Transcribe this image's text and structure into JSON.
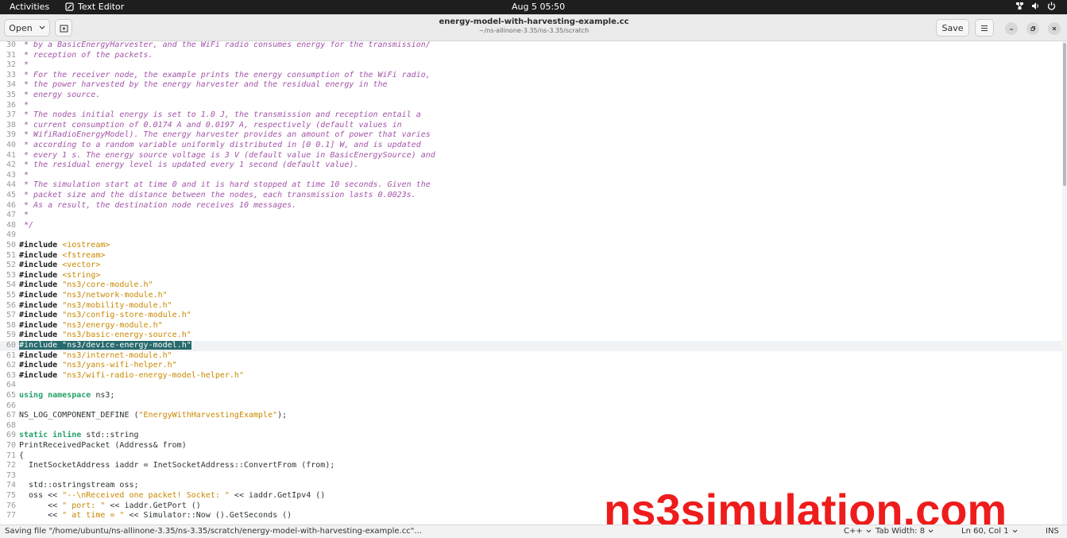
{
  "system": {
    "activities": "Activities",
    "app_name": "Text Editor",
    "clock": "Aug 5  05:50"
  },
  "header": {
    "open_label": "Open",
    "save_label": "Save",
    "title": "energy-model-with-harvesting-example.cc",
    "subtitle": "~/ns-allinone-3.35/ns-3.35/scratch"
  },
  "icons": {
    "app": "text-editor-icon",
    "open_dropdown": "chevron-down-icon",
    "new_tab": "new-tab-icon",
    "menu": "hamburger-menu-icon",
    "tray": [
      "network-icon",
      "volume-icon",
      "power-icon"
    ]
  },
  "colors": {
    "comment": "#a355a9",
    "keyword": "#26a269",
    "string": "#c88800",
    "selection": "#276a6c",
    "watermark": "#ee1c1c"
  },
  "editor": {
    "current_line": 60,
    "lines": [
      {
        "n": "30",
        "parts": [
          {
            "t": " * by a BasicEnergyHarvester, and the WiFi radio consumes energy for the transmission/",
            "c": "comment"
          }
        ]
      },
      {
        "n": "31",
        "parts": [
          {
            "t": " * reception of the packets.",
            "c": "comment"
          }
        ]
      },
      {
        "n": "32",
        "parts": [
          {
            "t": " *",
            "c": "comment"
          }
        ]
      },
      {
        "n": "33",
        "parts": [
          {
            "t": " * For the receiver node, the example prints the energy consumption of the WiFi radio,",
            "c": "comment"
          }
        ]
      },
      {
        "n": "34",
        "parts": [
          {
            "t": " * the power harvested by the energy harvester and the residual energy in the",
            "c": "comment"
          }
        ]
      },
      {
        "n": "35",
        "parts": [
          {
            "t": " * energy source.",
            "c": "comment"
          }
        ]
      },
      {
        "n": "36",
        "parts": [
          {
            "t": " *",
            "c": "comment"
          }
        ]
      },
      {
        "n": "37",
        "parts": [
          {
            "t": " * The nodes initial energy is set to 1.0 J, the transmission and reception entail a",
            "c": "comment"
          }
        ]
      },
      {
        "n": "38",
        "parts": [
          {
            "t": " * current consumption of 0.0174 A and 0.0197 A, respectively (default values in",
            "c": "comment"
          }
        ]
      },
      {
        "n": "39",
        "parts": [
          {
            "t": " * WifiRadioEnergyModel). The energy harvester provides an amount of power that varies",
            "c": "comment"
          }
        ]
      },
      {
        "n": "40",
        "parts": [
          {
            "t": " * according to a random variable uniformly distributed in [0 0.1] W, and is updated",
            "c": "comment"
          }
        ]
      },
      {
        "n": "41",
        "parts": [
          {
            "t": " * every 1 s. The energy source voltage is 3 V (default value in BasicEnergySource) and",
            "c": "comment"
          }
        ]
      },
      {
        "n": "42",
        "parts": [
          {
            "t": " * the residual energy level is updated every 1 second (default value).",
            "c": "comment"
          }
        ]
      },
      {
        "n": "43",
        "parts": [
          {
            "t": " *",
            "c": "comment"
          }
        ]
      },
      {
        "n": "44",
        "parts": [
          {
            "t": " * The simulation start at time 0 and it is hard stopped at time 10 seconds. Given the",
            "c": "comment"
          }
        ]
      },
      {
        "n": "45",
        "parts": [
          {
            "t": " * packet size and the distance between the nodes, each transmission lasts 0.0023s.",
            "c": "comment"
          }
        ]
      },
      {
        "n": "46",
        "parts": [
          {
            "t": " * As a result, the destination node receives 10 messages.",
            "c": "comment"
          }
        ]
      },
      {
        "n": "47",
        "parts": [
          {
            "t": " *",
            "c": "comment"
          }
        ]
      },
      {
        "n": "48",
        "parts": [
          {
            "t": " */",
            "c": "comment"
          }
        ]
      },
      {
        "n": "49",
        "parts": []
      },
      {
        "n": "50",
        "parts": [
          {
            "t": "#include ",
            "c": "preproc"
          },
          {
            "t": "<iostream>",
            "c": "string"
          }
        ]
      },
      {
        "n": "51",
        "parts": [
          {
            "t": "#include ",
            "c": "preproc"
          },
          {
            "t": "<fstream>",
            "c": "string"
          }
        ]
      },
      {
        "n": "52",
        "parts": [
          {
            "t": "#include ",
            "c": "preproc"
          },
          {
            "t": "<vector>",
            "c": "string"
          }
        ]
      },
      {
        "n": "53",
        "parts": [
          {
            "t": "#include ",
            "c": "preproc"
          },
          {
            "t": "<string>",
            "c": "string"
          }
        ]
      },
      {
        "n": "54",
        "parts": [
          {
            "t": "#include ",
            "c": "preproc"
          },
          {
            "t": "\"ns3/core-module.h\"",
            "c": "string"
          }
        ]
      },
      {
        "n": "55",
        "parts": [
          {
            "t": "#include ",
            "c": "preproc"
          },
          {
            "t": "\"ns3/network-module.h\"",
            "c": "string"
          }
        ]
      },
      {
        "n": "56",
        "parts": [
          {
            "t": "#include ",
            "c": "preproc"
          },
          {
            "t": "\"ns3/mobility-module.h\"",
            "c": "string"
          }
        ]
      },
      {
        "n": "57",
        "parts": [
          {
            "t": "#include ",
            "c": "preproc"
          },
          {
            "t": "\"ns3/config-store-module.h\"",
            "c": "string"
          }
        ]
      },
      {
        "n": "58",
        "parts": [
          {
            "t": "#include ",
            "c": "preproc"
          },
          {
            "t": "\"ns3/energy-module.h\"",
            "c": "string"
          }
        ]
      },
      {
        "n": "59",
        "parts": [
          {
            "t": "#include ",
            "c": "preproc"
          },
          {
            "t": "\"ns3/basic-energy-source.h\"",
            "c": "string"
          }
        ]
      },
      {
        "n": "60",
        "parts": [
          {
            "t": "#include \"ns3/device-energy-model.h\"",
            "c": "selected"
          }
        ]
      },
      {
        "n": "61",
        "parts": [
          {
            "t": "#include ",
            "c": "preproc"
          },
          {
            "t": "\"ns3/internet-module.h\"",
            "c": "string"
          }
        ]
      },
      {
        "n": "62",
        "parts": [
          {
            "t": "#include ",
            "c": "preproc"
          },
          {
            "t": "\"ns3/yans-wifi-helper.h\"",
            "c": "string"
          }
        ]
      },
      {
        "n": "63",
        "parts": [
          {
            "t": "#include ",
            "c": "preproc"
          },
          {
            "t": "\"ns3/wifi-radio-energy-model-helper.h\"",
            "c": "string"
          }
        ]
      },
      {
        "n": "64",
        "parts": []
      },
      {
        "n": "65",
        "parts": [
          {
            "t": "using namespace",
            "c": "keyword"
          },
          {
            "t": " ns3;",
            "c": "plain"
          }
        ]
      },
      {
        "n": "66",
        "parts": []
      },
      {
        "n": "67",
        "parts": [
          {
            "t": "NS_LOG_COMPONENT_DEFINE (",
            "c": "plain"
          },
          {
            "t": "\"EnergyWithHarvestingExample\"",
            "c": "string"
          },
          {
            "t": ");",
            "c": "plain"
          }
        ]
      },
      {
        "n": "68",
        "parts": []
      },
      {
        "n": "69",
        "parts": [
          {
            "t": "static inline",
            "c": "keyword"
          },
          {
            "t": " std::string",
            "c": "plain"
          }
        ]
      },
      {
        "n": "70",
        "parts": [
          {
            "t": "PrintReceivedPacket (Address& from)",
            "c": "plain"
          }
        ]
      },
      {
        "n": "71",
        "parts": [
          {
            "t": "{",
            "c": "plain"
          }
        ]
      },
      {
        "n": "72",
        "parts": [
          {
            "t": "  InetSocketAddress iaddr = InetSocketAddress::ConvertFrom (from);",
            "c": "plain"
          }
        ]
      },
      {
        "n": "73",
        "parts": []
      },
      {
        "n": "74",
        "parts": [
          {
            "t": "  std::ostringstream oss;",
            "c": "plain"
          }
        ]
      },
      {
        "n": "75",
        "parts": [
          {
            "t": "  oss << ",
            "c": "plain"
          },
          {
            "t": "\"--\\nReceived one packet! Socket: \"",
            "c": "string"
          },
          {
            "t": " << iaddr.GetIpv4 ()",
            "c": "plain"
          }
        ]
      },
      {
        "n": "76",
        "parts": [
          {
            "t": "      << ",
            "c": "plain"
          },
          {
            "t": "\" port: \"",
            "c": "string"
          },
          {
            "t": " << iaddr.GetPort ()",
            "c": "plain"
          }
        ]
      },
      {
        "n": "77",
        "parts": [
          {
            "t": "      << ",
            "c": "plain"
          },
          {
            "t": "\" at time = \"",
            "c": "string"
          },
          {
            "t": " << Simulator::Now ().GetSeconds ()",
            "c": "plain"
          }
        ]
      }
    ]
  },
  "watermark": "ns3simulation.com",
  "status": {
    "message": "Saving file \"/home/ubuntu/ns-allinone-3.35/ns-3.35/scratch/energy-model-with-harvesting-example.cc\"…",
    "language": "C++",
    "tab_width": "Tab Width: 8",
    "position": "Ln 60, Col 1",
    "mode": "INS"
  }
}
